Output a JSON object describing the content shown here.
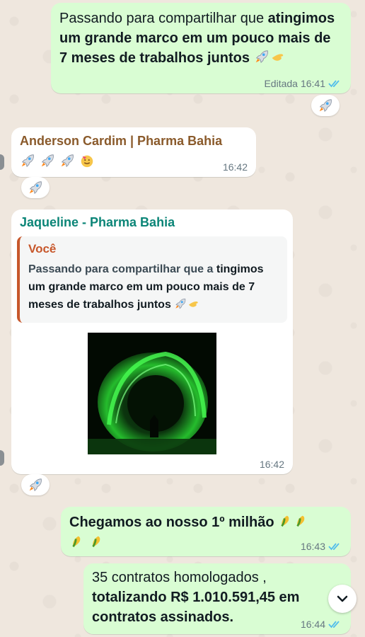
{
  "messages": [
    {
      "text_normal": "Passando para compartilhar que ",
      "text_bold": "atingimos um grande marco em um pouco mais de 7 meses de trabalhos juntos",
      "status": "Editada",
      "time": "16:41",
      "reaction_icon": "rocket-emoji"
    },
    {
      "sender": "Anderson Cardim | Pharma Bahia",
      "sender_color": "#8a5a2b",
      "time": "16:42",
      "icons": [
        "rocket-emoji",
        "rocket-emoji",
        "rocket-emoji",
        "partying-face-emoji"
      ],
      "reaction_icon": "rocket-emoji"
    },
    {
      "sender": "Jaqueline - Pharma Bahia",
      "sender_color": "#0b8577",
      "quote_author": "Você",
      "quote_text_normal": "Passando para compartilhar que a ",
      "quote_text_bold": "tingimos um grande marco em um pouco mais de 7 meses de trabalhos juntos",
      "media": "green-fireworks-image",
      "time": "16:42",
      "reaction_icon": "rocket-emoji"
    },
    {
      "text": "Chegamos ao nosso 1º milhão",
      "icons": [
        "corn-emoji",
        "corn-emoji",
        "corn-emoji",
        "corn-emoji"
      ],
      "time": "16:43"
    },
    {
      "line1": "35 contratos homologados ,",
      "line2": "totalizando R$ 1.010.591,45 em",
      "line3": "contratos assinados.",
      "time": "16:44"
    }
  ],
  "colors": {
    "outgoing_bubble": "#d9fdd3",
    "incoming_bubble": "#ffffff",
    "read_ticks": "#53bdeb",
    "background": "#efe7de"
  }
}
